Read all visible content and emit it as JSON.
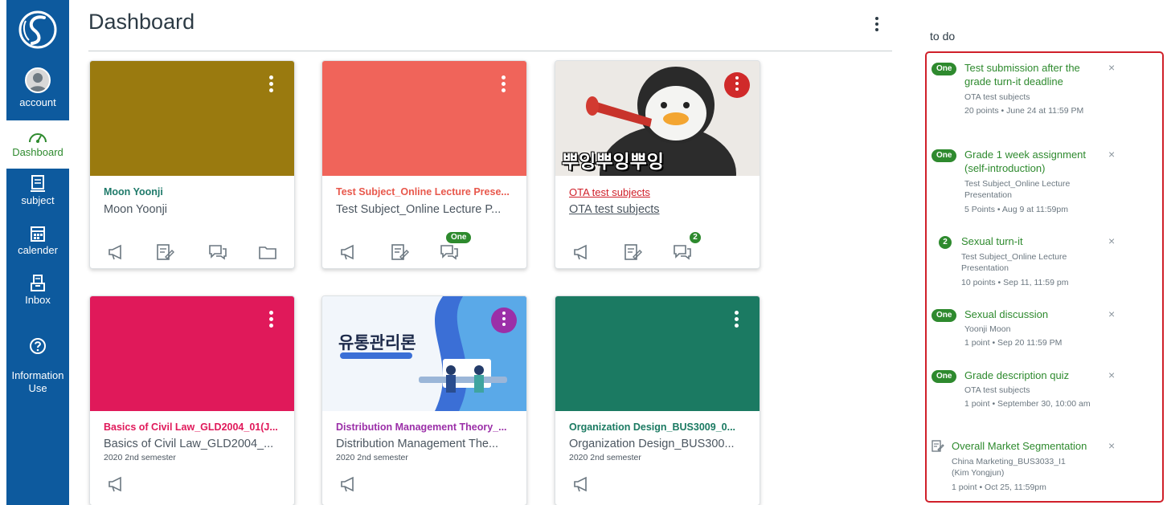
{
  "nav": {
    "items": [
      {
        "label": "account"
      },
      {
        "label": "Dashboard"
      },
      {
        "label": "subject"
      },
      {
        "label": "calender"
      },
      {
        "label": "Inbox"
      },
      {
        "label": "Information\nUse"
      }
    ],
    "accent_color": "#2e8a2e",
    "bg_color": "#0d5a9e"
  },
  "header": {
    "title": "Dashboard"
  },
  "cards": [
    {
      "title": "Moon Yoonji",
      "subtitle": "Moon Yoonji",
      "term": "",
      "color": "#9a7a0f",
      "title_color": "#1f7a6a",
      "icons": [
        "announcements-icon",
        "assignments-icon",
        "discussions-icon",
        "files-icon"
      ]
    },
    {
      "title": "Test Subject_Online Lecture Prese...",
      "subtitle": "Test Subject_Online Lecture P...",
      "term": "",
      "color": "#f0645a",
      "title_color": "#e8584c",
      "icons": [
        "announcements-icon",
        "assignments-icon",
        "discussions-icon"
      ],
      "badge": "One"
    },
    {
      "title": "OTA test subjects",
      "subtitle": "OTA test subjects",
      "term": "",
      "color": "#d02a2a",
      "title_color": "#d0202a",
      "icons": [
        "announcements-icon",
        "assignments-icon",
        "discussions-icon"
      ],
      "badge": "2",
      "hero_text": "뿌잉뿌잉뿌잉"
    },
    {
      "title": "Basics of Civil Law_GLD2004_01(J...",
      "subtitle": "Basics of Civil Law_GLD2004_...",
      "term": "2020 2nd semester",
      "color": "#e0195a",
      "title_color": "#e0195a",
      "icons": [
        "announcements-icon"
      ]
    },
    {
      "title": "Distribution Management Theory_...",
      "subtitle": "Distribution Management The...",
      "term": "2020 2nd semester",
      "color": "#9b2fa8",
      "title_color": "#9b2fa8",
      "icons": [
        "announcements-icon"
      ],
      "hero_text": "유통관리론"
    },
    {
      "title": "Organization Design_BUS3009_0...",
      "subtitle": "Organization Design_BUS300...",
      "term": "2020 2nd semester",
      "color": "#1b7a62",
      "title_color": "#1b7a62",
      "icons": [
        "announcements-icon"
      ]
    }
  ],
  "todo": {
    "heading": "to do",
    "items": [
      {
        "badge": "One",
        "title": "Test submission after the grade turn-it deadline",
        "course": "OTA test subjects",
        "meta": "20 points • June 24 at 11:59 PM"
      },
      {
        "badge": "One",
        "title": "Grade 1 week assignment (self-introduction)",
        "course": "Test Subject_Online Lecture Presentation",
        "meta": "5 Points • Aug 9 at 11:59pm"
      },
      {
        "badge": "2",
        "title": "Sexual turn-it",
        "course": "Test Subject_Online Lecture Presentation",
        "meta": "10 points • Sep 11, 11:59 pm"
      },
      {
        "badge": "One",
        "title": "Sexual discussion",
        "course": "Yoonji Moon",
        "meta": "1 point • Sep 20 11:59 PM"
      },
      {
        "badge": "One",
        "title": "Grade description quiz",
        "course": "OTA test subjects",
        "meta": "1 point • September 30, 10:00 am"
      },
      {
        "badge": "",
        "icon": "assignment-icon",
        "title": "Overall Market Segmentation",
        "course": "China Marketing_BUS3033_I1 (Kim Yongjun)",
        "meta": "1 point • Oct 25, 11:59pm"
      }
    ],
    "close_glyph": "×"
  }
}
